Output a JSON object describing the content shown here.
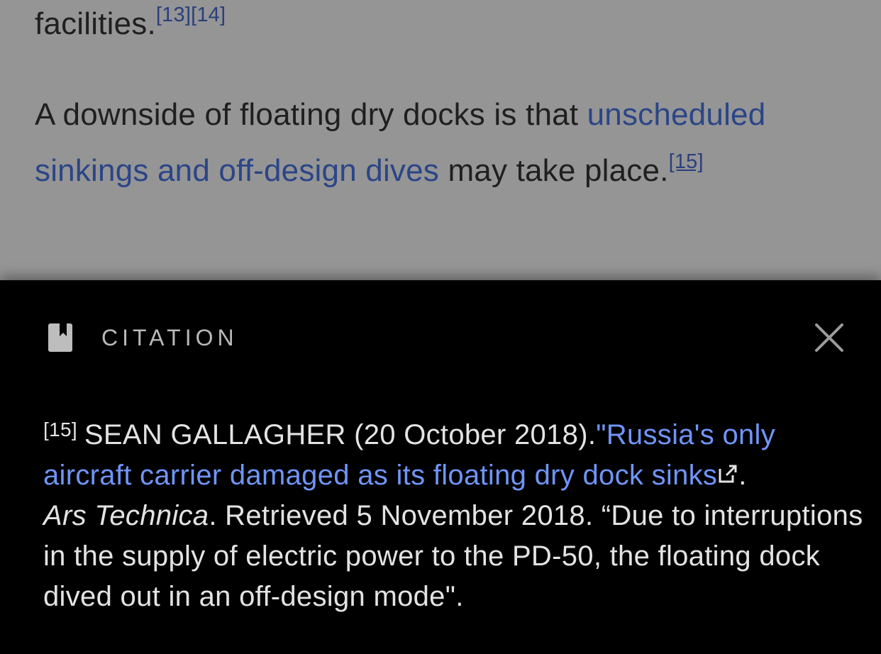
{
  "article": {
    "p1_text": "facilities.",
    "p1_ref1": "[13]",
    "p1_ref2": "[14]",
    "p2_text_start": "A downside of floating dry docks is that ",
    "p2_link": "unscheduled sinkings and off-design dives",
    "p2_text_mid": " may take place.",
    "p2_ref": "[15]"
  },
  "citation_panel": {
    "icon": "bookmark-icon",
    "title": "CITATION",
    "close_icon": "close-icon",
    "ref_number": "[15]",
    "author_date": "SEAN GALLAGHER (20 October 2018).",
    "link_text": "\"Russia's only aircraft carrier damaged as its floating dry dock sinks",
    "external_link_icon": "external-link-icon",
    "after_link": ".",
    "publication": "Ars Technica",
    "retrieved": ". Retrieved 5 November 2018. “Due to interruptions in the supply of electric power to the PD-50, the floating dock dived out in an off-design mode",
    "closing_quote": "\".",
    "colors": {
      "background_dim": "#959595",
      "panel_bg": "#000000",
      "link": "#7094f7",
      "article_link": "#2b4587"
    }
  }
}
